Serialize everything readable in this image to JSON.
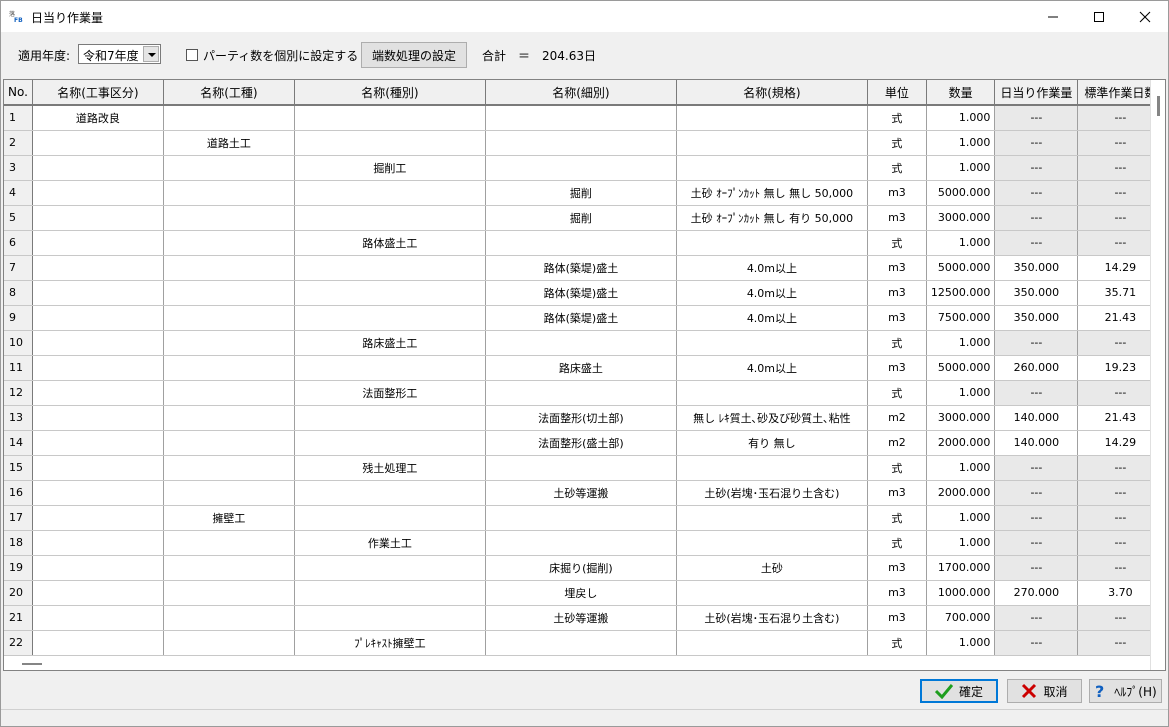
{
  "window": {
    "title": "日当り作業量",
    "icon_label": "落FB"
  },
  "toolbar": {
    "year_label": "適用年度:",
    "year_value": "令和7年度",
    "party_checkbox_label": "パーティ数を個別に設定する",
    "party_checkbox_checked": false,
    "rounding_button": "端数処理の設定",
    "total_label": "合計　＝　204.63日"
  },
  "grid": {
    "columns": [
      "No.",
      "名称(工事区分)",
      "名称(工種)",
      "名称(種別)",
      "名称(細別)",
      "名称(規格)",
      "単位",
      "数量",
      "日当り作業量",
      "標準作業日数"
    ],
    "rows": [
      {
        "no": "1",
        "c1": "道路改良",
        "c2": "",
        "c3": "",
        "c4": "",
        "c5": "",
        "unit": "式",
        "qty": "1.000",
        "daily": "---",
        "days": "---"
      },
      {
        "no": "2",
        "c1": "",
        "c2": "道路土工",
        "c3": "",
        "c4": "",
        "c5": "",
        "unit": "式",
        "qty": "1.000",
        "daily": "---",
        "days": "---"
      },
      {
        "no": "3",
        "c1": "",
        "c2": "",
        "c3": "掘削工",
        "c4": "",
        "c5": "",
        "unit": "式",
        "qty": "1.000",
        "daily": "---",
        "days": "---"
      },
      {
        "no": "4",
        "c1": "",
        "c2": "",
        "c3": "",
        "c4": "掘削",
        "c5": "土砂 ｵｰﾌﾟﾝｶｯﾄ 無し 無し 50,000",
        "unit": "m3",
        "qty": "5000.000",
        "daily": "---",
        "days": "---"
      },
      {
        "no": "5",
        "c1": "",
        "c2": "",
        "c3": "",
        "c4": "掘削",
        "c5": "土砂 ｵｰﾌﾟﾝｶｯﾄ 無し 有り 50,000",
        "unit": "m3",
        "qty": "3000.000",
        "daily": "---",
        "days": "---"
      },
      {
        "no": "6",
        "c1": "",
        "c2": "",
        "c3": "路体盛土工",
        "c4": "",
        "c5": "",
        "unit": "式",
        "qty": "1.000",
        "daily": "---",
        "days": "---"
      },
      {
        "no": "7",
        "c1": "",
        "c2": "",
        "c3": "",
        "c4": "路体(築堤)盛土",
        "c5": "4.0m以上",
        "unit": "m3",
        "qty": "5000.000",
        "daily": "350.000",
        "days": "14.29"
      },
      {
        "no": "8",
        "c1": "",
        "c2": "",
        "c3": "",
        "c4": "路体(築堤)盛土",
        "c5": "4.0m以上",
        "unit": "m3",
        "qty": "12500.000",
        "daily": "350.000",
        "days": "35.71"
      },
      {
        "no": "9",
        "c1": "",
        "c2": "",
        "c3": "",
        "c4": "路体(築堤)盛土",
        "c5": "4.0m以上",
        "unit": "m3",
        "qty": "7500.000",
        "daily": "350.000",
        "days": "21.43"
      },
      {
        "no": "10",
        "c1": "",
        "c2": "",
        "c3": "路床盛土工",
        "c4": "",
        "c5": "",
        "unit": "式",
        "qty": "1.000",
        "daily": "---",
        "days": "---"
      },
      {
        "no": "11",
        "c1": "",
        "c2": "",
        "c3": "",
        "c4": "路床盛土",
        "c5": "4.0m以上",
        "unit": "m3",
        "qty": "5000.000",
        "daily": "260.000",
        "days": "19.23"
      },
      {
        "no": "12",
        "c1": "",
        "c2": "",
        "c3": "法面整形工",
        "c4": "",
        "c5": "",
        "unit": "式",
        "qty": "1.000",
        "daily": "---",
        "days": "---"
      },
      {
        "no": "13",
        "c1": "",
        "c2": "",
        "c3": "",
        "c4": "法面整形(切土部)",
        "c5": "無し ﾚｷ質土､砂及び砂質土､粘性",
        "unit": "m2",
        "qty": "3000.000",
        "daily": "140.000",
        "days": "21.43"
      },
      {
        "no": "14",
        "c1": "",
        "c2": "",
        "c3": "",
        "c4": "法面整形(盛土部)",
        "c5": "有り 無し",
        "unit": "m2",
        "qty": "2000.000",
        "daily": "140.000",
        "days": "14.29"
      },
      {
        "no": "15",
        "c1": "",
        "c2": "",
        "c3": "残土処理工",
        "c4": "",
        "c5": "",
        "unit": "式",
        "qty": "1.000",
        "daily": "---",
        "days": "---"
      },
      {
        "no": "16",
        "c1": "",
        "c2": "",
        "c3": "",
        "c4": "土砂等運搬",
        "c5": "土砂(岩塊･玉石混り土含む)",
        "unit": "m3",
        "qty": "2000.000",
        "daily": "---",
        "days": "---"
      },
      {
        "no": "17",
        "c1": "",
        "c2": "擁壁工",
        "c3": "",
        "c4": "",
        "c5": "",
        "unit": "式",
        "qty": "1.000",
        "daily": "---",
        "days": "---"
      },
      {
        "no": "18",
        "c1": "",
        "c2": "",
        "c3": "作業土工",
        "c4": "",
        "c5": "",
        "unit": "式",
        "qty": "1.000",
        "daily": "---",
        "days": "---"
      },
      {
        "no": "19",
        "c1": "",
        "c2": "",
        "c3": "",
        "c4": "床掘り(掘削)",
        "c5": "土砂",
        "unit": "m3",
        "qty": "1700.000",
        "daily": "---",
        "days": "---"
      },
      {
        "no": "20",
        "c1": "",
        "c2": "",
        "c3": "",
        "c4": "埋戻し",
        "c5": "",
        "unit": "m3",
        "qty": "1000.000",
        "daily": "270.000",
        "days": "3.70"
      },
      {
        "no": "21",
        "c1": "",
        "c2": "",
        "c3": "",
        "c4": "土砂等運搬",
        "c5": "土砂(岩塊･玉石混り土含む)",
        "unit": "m3",
        "qty": "700.000",
        "daily": "---",
        "days": "---"
      },
      {
        "no": "22",
        "c1": "",
        "c2": "",
        "c3": "ﾌﾟﾚｷｬｽﾄ擁壁工",
        "c4": "",
        "c5": "",
        "unit": "式",
        "qty": "1.000",
        "daily": "---",
        "days": "---"
      }
    ]
  },
  "footer": {
    "ok_label": "確定",
    "cancel_label": "取消",
    "help_label": "ﾍﾙﾌﾟ(H)"
  },
  "colors": {
    "accent": "#0078d7",
    "ok_check": "#1e9e1e",
    "cancel_x": "#cc0000",
    "help_q": "#1060c0"
  },
  "icons": {
    "ok": "checkmark-icon",
    "cancel": "x-icon",
    "help": "question-icon"
  }
}
